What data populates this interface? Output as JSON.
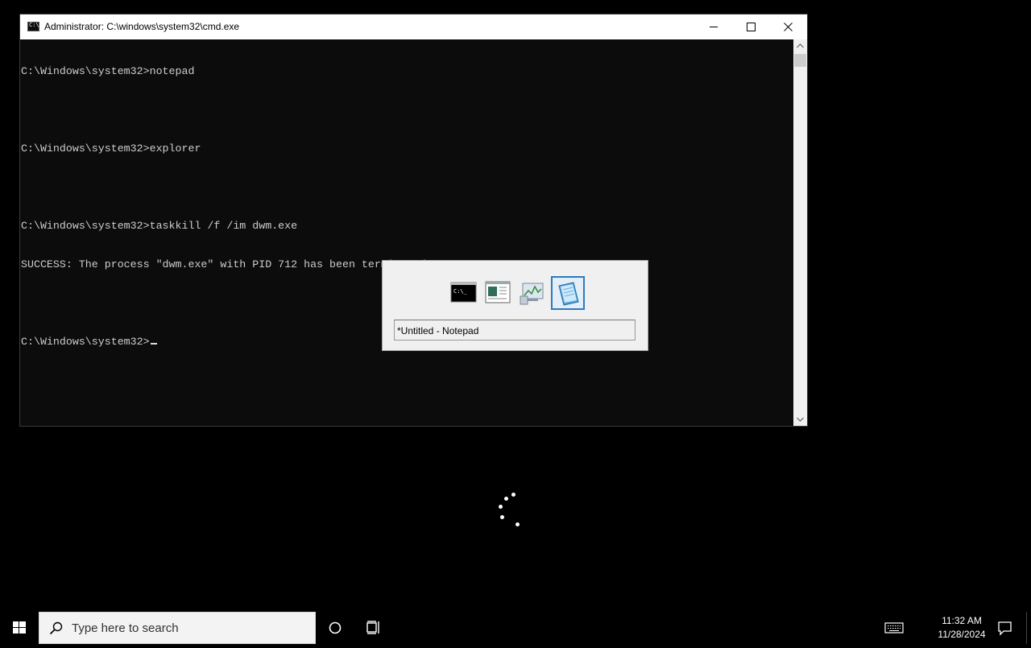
{
  "cmd_window": {
    "title": "Administrator: C:\\windows\\system32\\cmd.exe",
    "lines": [
      "C:\\Windows\\system32>notepad",
      "",
      "C:\\Windows\\system32>explorer",
      "",
      "C:\\Windows\\system32>taskkill /f /im dwm.exe",
      "SUCCESS: The process \"dwm.exe\" with PID 712 has been terminated.",
      "",
      "C:\\Windows\\system32>"
    ]
  },
  "switcher": {
    "caption": "*Untitled - Notepad",
    "icons": [
      "cmd-icon",
      "document-icon",
      "performance-monitor-icon",
      "notepad-icon"
    ],
    "selected_index": 3
  },
  "taskbar": {
    "search_placeholder": "Type here to search",
    "time": "11:32 AM",
    "date": "11/28/2024"
  },
  "colors": {
    "console_bg": "#0c0c0c",
    "console_text": "#cccccc",
    "selection_border": "#2a7bc2"
  }
}
